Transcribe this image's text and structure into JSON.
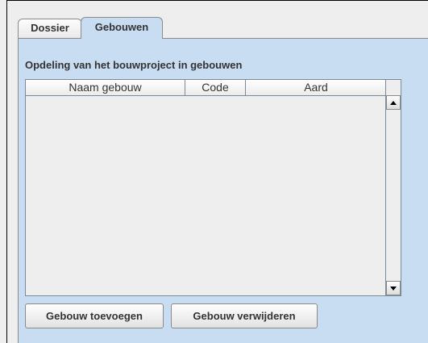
{
  "tabs": [
    {
      "label": "Dossier",
      "selected": false
    },
    {
      "label": "Gebouwen",
      "selected": true
    }
  ],
  "panel": {
    "section_title": "Opdeling van het bouwproject in gebouwen"
  },
  "table": {
    "columns": [
      "Naam gebouw",
      "Code",
      "Aard"
    ],
    "rows": []
  },
  "buttons": {
    "add_label": "Gebouw toevoegen",
    "remove_label": "Gebouw verwijderen"
  },
  "colors": {
    "panel_background": "#c8ddf2",
    "window_background": "#eeeeee"
  }
}
